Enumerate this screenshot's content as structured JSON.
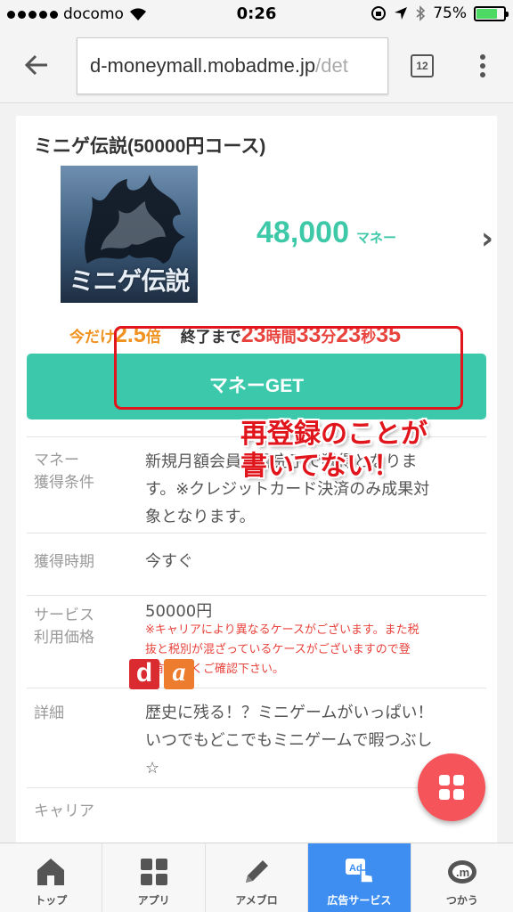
{
  "status_bar": {
    "carrier": "docomo",
    "time": "0:26",
    "battery_percent": "75%",
    "battery_level": 0.75
  },
  "browser": {
    "url_domain": "d-moneymall.mobadme.jp",
    "url_path": "/det",
    "tab_count": "12"
  },
  "offer": {
    "title": "ミニゲ伝説(50000円コース)",
    "thumbnail_text": "ミニゲ伝説",
    "money_amount": "48,000",
    "money_unit": "マネー",
    "promo": {
      "now_only": "今だけ",
      "multiplier": "2.5",
      "times": "倍",
      "until_end": "終了まで",
      "hours": "23",
      "hours_unit": "時間",
      "minutes": "33",
      "minutes_unit": "分",
      "seconds": "23",
      "seconds_unit": "秒",
      "ms": "35"
    },
    "get_button": "マネーGET"
  },
  "details": {
    "condition_label_1": "マネー",
    "condition_label_2": "獲得条件",
    "condition_line_1": "新規月額会員登録完了で獲得となりま",
    "condition_line_2": "す。※クレジットカード決済のみ成果対",
    "condition_line_3": "象となります。",
    "timing_label": "獲得時期",
    "timing_value": "今すぐ",
    "price_label_1": "サービス",
    "price_label_2": "利用価格",
    "price_value": "50000円",
    "price_note_1": "※キャリアにより異なるケースがございます。また税",
    "price_note_2": "抜と税別が混ざっているケースがございますので登",
    "price_note_3": "録前によくご確認下さい。",
    "detail_label": "詳細",
    "detail_line_1": "歴史に残る！？ミニゲームがいっぱい！",
    "detail_line_2": "いつでもどこでもミニゲームで暇つぶし",
    "detail_line_3": "☆",
    "carrier_label": "キャリア",
    "carrier_d": "d",
    "carrier_a": "a"
  },
  "annotation": {
    "line_1": "再登録のことが",
    "line_2": "書いてない！"
  },
  "tabbar": {
    "items": [
      {
        "label": "トップ",
        "icon": "home-icon"
      },
      {
        "label": "アプリ",
        "icon": "apps-grid-icon"
      },
      {
        "label": "アメブロ",
        "icon": "pencil-icon"
      },
      {
        "label": "広告サービス",
        "icon": "ad-tap-icon",
        "active": true
      },
      {
        "label": "つかう",
        "icon": "money-coin-icon"
      }
    ]
  },
  "colors": {
    "accent_green": "#3cc9ab",
    "promo_orange": "#f0921f",
    "countdown_red": "#e8433c",
    "annotation_red": "#e0161c",
    "fab_red": "#f4545a",
    "active_tab_blue": "#3d8ef0"
  }
}
